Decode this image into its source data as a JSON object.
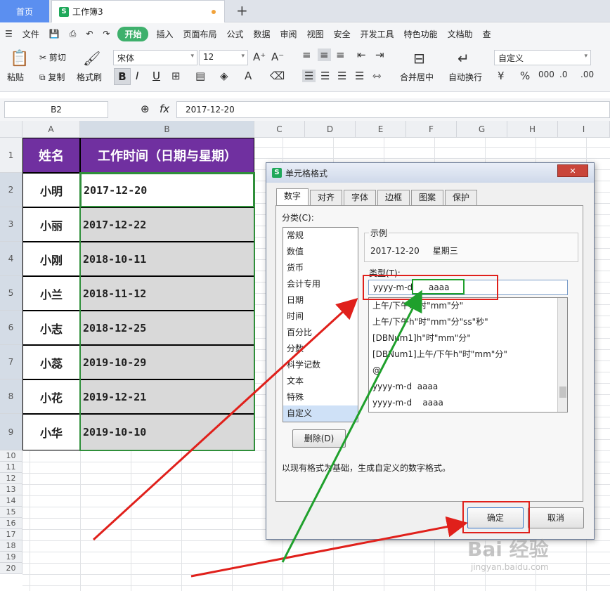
{
  "tabs": {
    "home": "首页",
    "book": "工作簿3"
  },
  "menu": [
    "文件",
    "开始",
    "插入",
    "页面布局",
    "公式",
    "数据",
    "审阅",
    "视图",
    "安全",
    "开发工具",
    "特色功能",
    "文档助",
    "查"
  ],
  "ribbon": {
    "paste": "粘贴",
    "cut": "剪切",
    "copy": "复制",
    "format_painter": "格式刷",
    "font": "宋体",
    "size": "12",
    "merge": "合并居中",
    "wrap": "自动换行",
    "numfmt": "自定义",
    "bold": "B",
    "italic": "I",
    "underline": "U"
  },
  "formula": {
    "cell": "B2",
    "fx": "fx",
    "value": "2017-12-20"
  },
  "columns": [
    "A",
    "B",
    "C",
    "D",
    "E",
    "F",
    "G",
    "H",
    "I"
  ],
  "rows": [
    "1",
    "2",
    "3",
    "4",
    "5",
    "6",
    "7",
    "8",
    "9",
    "10",
    "11",
    "12",
    "13",
    "14",
    "15",
    "16",
    "17",
    "18",
    "19",
    "20"
  ],
  "table": {
    "h1": "姓名",
    "h2": "工作时间（日期与星期）",
    "names": [
      "小明",
      "小丽",
      "小刚",
      "小兰",
      "小志",
      "小蕊",
      "小花",
      "小华"
    ],
    "dates": [
      "2017-12-20",
      "2017-12-22",
      "2018-10-11",
      "2018-11-12",
      "2018-12-25",
      "2019-10-29",
      "2019-12-21",
      "2019-10-10"
    ]
  },
  "dialog": {
    "title": "单元格格式",
    "tabs": [
      "数字",
      "对齐",
      "字体",
      "边框",
      "图案",
      "保护"
    ],
    "category_label": "分类(C):",
    "categories": [
      "常规",
      "数值",
      "货币",
      "会计专用",
      "日期",
      "时间",
      "百分比",
      "分数",
      "科学记数",
      "文本",
      "特殊",
      "自定义"
    ],
    "sample_label": "示例",
    "sample": "2017-12-20     星期三",
    "type_label": "类型(T):",
    "type_value": "yyyy-m-d      aaaa",
    "formats": [
      "上午/下午h\"时\"mm\"分\"",
      "上午/下午h\"时\"mm\"分\"ss\"秒\"",
      "[DBNum1]h\"时\"mm\"分\"",
      "[DBNum1]上午/下午h\"时\"mm\"分\"",
      "@",
      "yyyy-m-d  aaaa",
      "yyyy-m-d    aaaa"
    ],
    "delete": "删除(D)",
    "hint": "以现有格式为基础，生成自定义的数字格式。",
    "ok": "确定",
    "cancel": "取消",
    "close": "✕"
  },
  "watermark": "Bai 经验",
  "watermark_url": "jingyan.baidu.com"
}
